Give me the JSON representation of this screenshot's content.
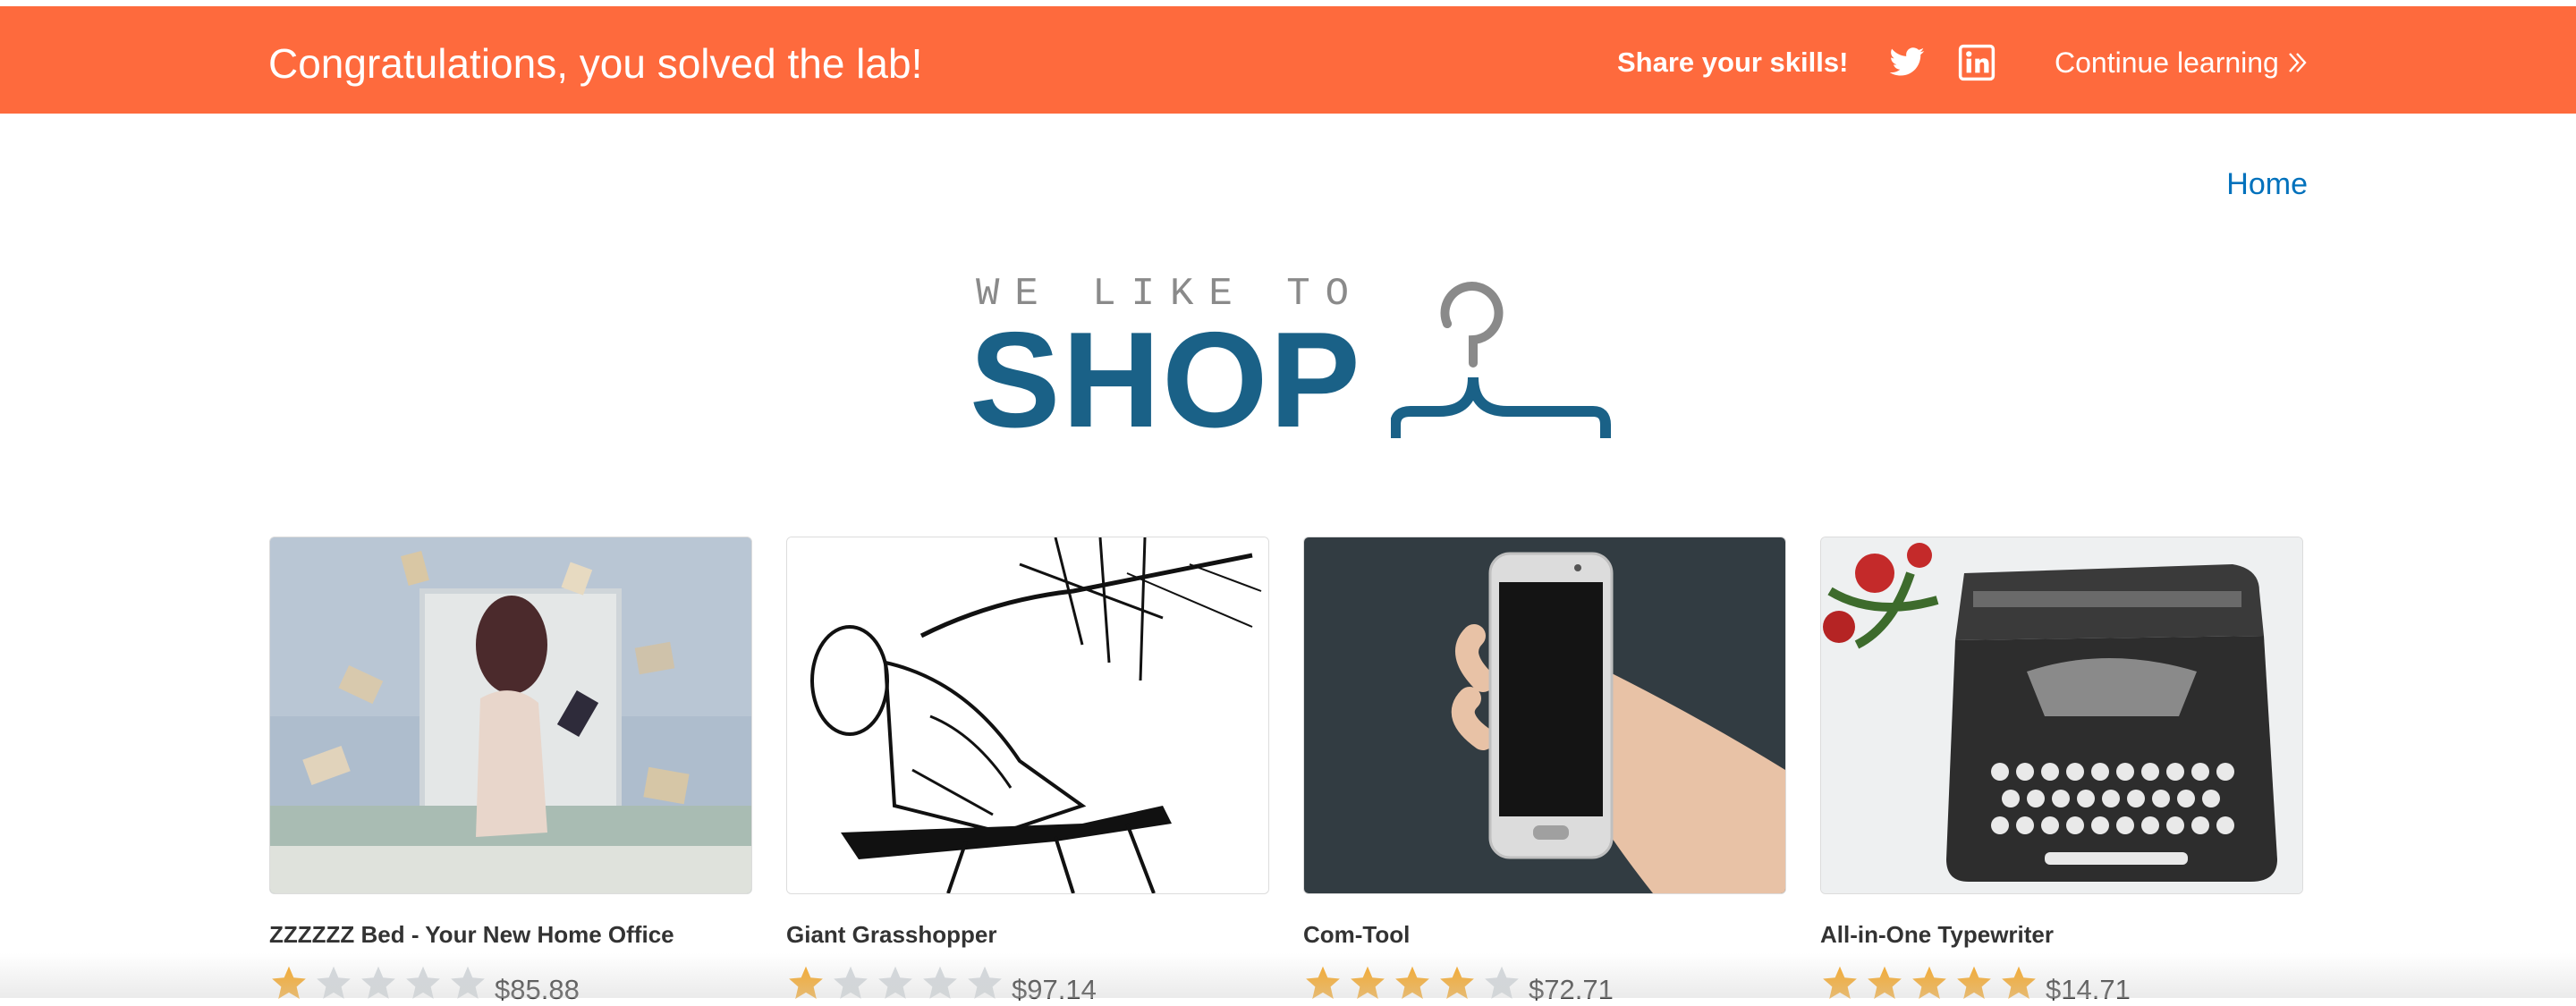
{
  "banner": {
    "title": "Congratulations, you solved the lab!",
    "share_label": "Share your skills!",
    "continue_label": "Continue learning",
    "background": "#fe6a3d"
  },
  "nav": {
    "home_label": "Home"
  },
  "logo": {
    "small_text": "WE LIKE TO",
    "big_text": "SHOP"
  },
  "products": [
    {
      "name": "ZZZZZZ Bed - Your New Home Office",
      "rating": 1,
      "max_rating": 5,
      "price": "$85.88"
    },
    {
      "name": "Giant Grasshopper",
      "rating": 1,
      "max_rating": 5,
      "price": "$97.14"
    },
    {
      "name": "Com-Tool",
      "rating": 4,
      "max_rating": 5,
      "price": "$72.71"
    },
    {
      "name": "All-in-One Typewriter",
      "rating": 5,
      "max_rating": 5,
      "price": "$14.71"
    }
  ],
  "colors": {
    "accent": "#fe6a3d",
    "link": "#0071bc",
    "logo": "#1a6187",
    "star": "#f6a623"
  }
}
